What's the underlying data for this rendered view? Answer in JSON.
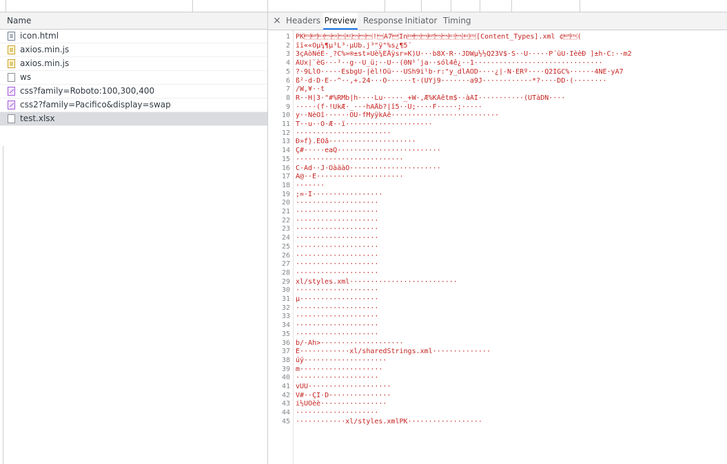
{
  "network_panel": {
    "column_header": "Name",
    "files": [
      {
        "name": "icon.html",
        "icon": "html-file-icon"
      },
      {
        "name": "axios.min.js",
        "icon": "js-file-icon"
      },
      {
        "name": "axios.min.js",
        "icon": "js-file-icon"
      },
      {
        "name": "ws",
        "icon": "blank-file-icon"
      },
      {
        "name": "css?family=Roboto:100,300,400",
        "icon": "css-file-icon"
      },
      {
        "name": "css2?family=Pacifico&display=swap",
        "icon": "css-file-icon"
      },
      {
        "name": "test.xlsx",
        "icon": "xlsx-file-icon",
        "selected": true
      }
    ]
  },
  "detail_panel": {
    "close_label": "×",
    "tabs": [
      {
        "label": "Headers",
        "active": false
      },
      {
        "label": "Preview",
        "active": true
      },
      {
        "label": "Response",
        "active": false
      },
      {
        "label": "Initiator",
        "active": false
      },
      {
        "label": "Timing",
        "active": false
      }
    ],
    "accent_color": "#1a73e8",
    "binary_text_color": "#c5221f",
    "lines": [
      {
        "n": "1",
        "text": "PK\u0003\u0004\u0014\u0000\u0006\u0000\b\u0000\u0000\u0000!\u0000A7Ïn\u0001\u0000\u0000\u0004\u0000\u0000\u0013\u0000\b\u0002[Content_Types].xml ¢\u0004\u0002("
      },
      {
        "n": "2",
        "text": "ïï««Óµ¼¶µ³L³·µUb.j³\"ÿ\"%s¿¶5´"
      },
      {
        "n": "3",
        "text": "3çÄòNéÈ·¸?C%»®±st»Ùè¼ÈÅÿsr»K)U···b8X·R··JDWµ½½Q23V$·S··U·····P´üU·IèèÐ ]±h·C:··m2"
      },
      {
        "n": "4",
        "text": "ÂUx|`èG···¹··g··U_ü;··U··(0N¹´ja··sól4ê¿··1·······························"
      },
      {
        "n": "5",
        "text": "?·9LlÒ·····EsbgU·|èl!Òü···USh9i¹b·r:\"y_dlÀÓD····¿|-N·ERº····Q2IGC%······4ÑÉ·yA7"
      },
      {
        "n": "6",
        "text": "ß²·d·D·E··^··,+.24···Ö······t·(UYj9·······a9J············*?····DD·(········"
      },
      {
        "n": "7",
        "text": "/W,¥··t"
      },
      {
        "n": "8",
        "text": "R··H|3·\"#%RMb|h····Lu·····_+W·,Æ%KÀêtm$·-àÁI···········(UTàDN····"
      },
      {
        "n": "9",
        "text": "·····(f·!UkÆ·_···hAÅb?|î5··U;····F·····;·····"
      },
      {
        "n": "10",
        "text": "y··NèOî······ÕU·fMyÿkÄê··························"
      },
      {
        "n": "11",
        "text": "T··u··Ö·Æ··ï·····················"
      },
      {
        "n": "12",
        "text": "·······················"
      },
      {
        "n": "13",
        "text": "Ð»f}.ÈÖå·····················"
      },
      {
        "n": "14",
        "text": "Ç#·····eaQ·························"
      },
      {
        "n": "15",
        "text": "··························"
      },
      {
        "n": "16",
        "text": "C·Äd··J·ÖàäàÖ······················"
      },
      {
        "n": "17",
        "text": "Á@··E·····················"
      },
      {
        "n": "18",
        "text": "·······"
      },
      {
        "n": "19",
        "text": ";=·I·················"
      },
      {
        "n": "20",
        "text": "····················"
      },
      {
        "n": "21",
        "text": "····················"
      },
      {
        "n": "22",
        "text": "····················"
      },
      {
        "n": "23",
        "text": "····················"
      },
      {
        "n": "24",
        "text": "····················"
      },
      {
        "n": "25",
        "text": "····················"
      },
      {
        "n": "26",
        "text": "····················"
      },
      {
        "n": "27",
        "text": "····················"
      },
      {
        "n": "28",
        "text": "····················"
      },
      {
        "n": "29",
        "text": "xl/styles.xml··························"
      },
      {
        "n": "30",
        "text": "····················"
      },
      {
        "n": "31",
        "text": "µ···················"
      },
      {
        "n": "32",
        "text": "····················"
      },
      {
        "n": "33",
        "text": "····················"
      },
      {
        "n": "34",
        "text": "····················"
      },
      {
        "n": "35",
        "text": "····················"
      },
      {
        "n": "36",
        "text": "b/·Äh>····················"
      },
      {
        "n": "37",
        "text": "E············xl/sharedStrings.xml··············"
      },
      {
        "n": "38",
        "text": "úý····················"
      },
      {
        "n": "39",
        "text": "m····················"
      },
      {
        "n": "40",
        "text": "····················"
      },
      {
        "n": "41",
        "text": "vÚÛ····················"
      },
      {
        "n": "42",
        "text": "V#··ÇI·D···············"
      },
      {
        "n": "43",
        "text": "i½UÖèè················"
      },
      {
        "n": "44",
        "text": "····················"
      },
      {
        "n": "45",
        "text": "············xl/styles.xmlPK··················"
      }
    ]
  }
}
